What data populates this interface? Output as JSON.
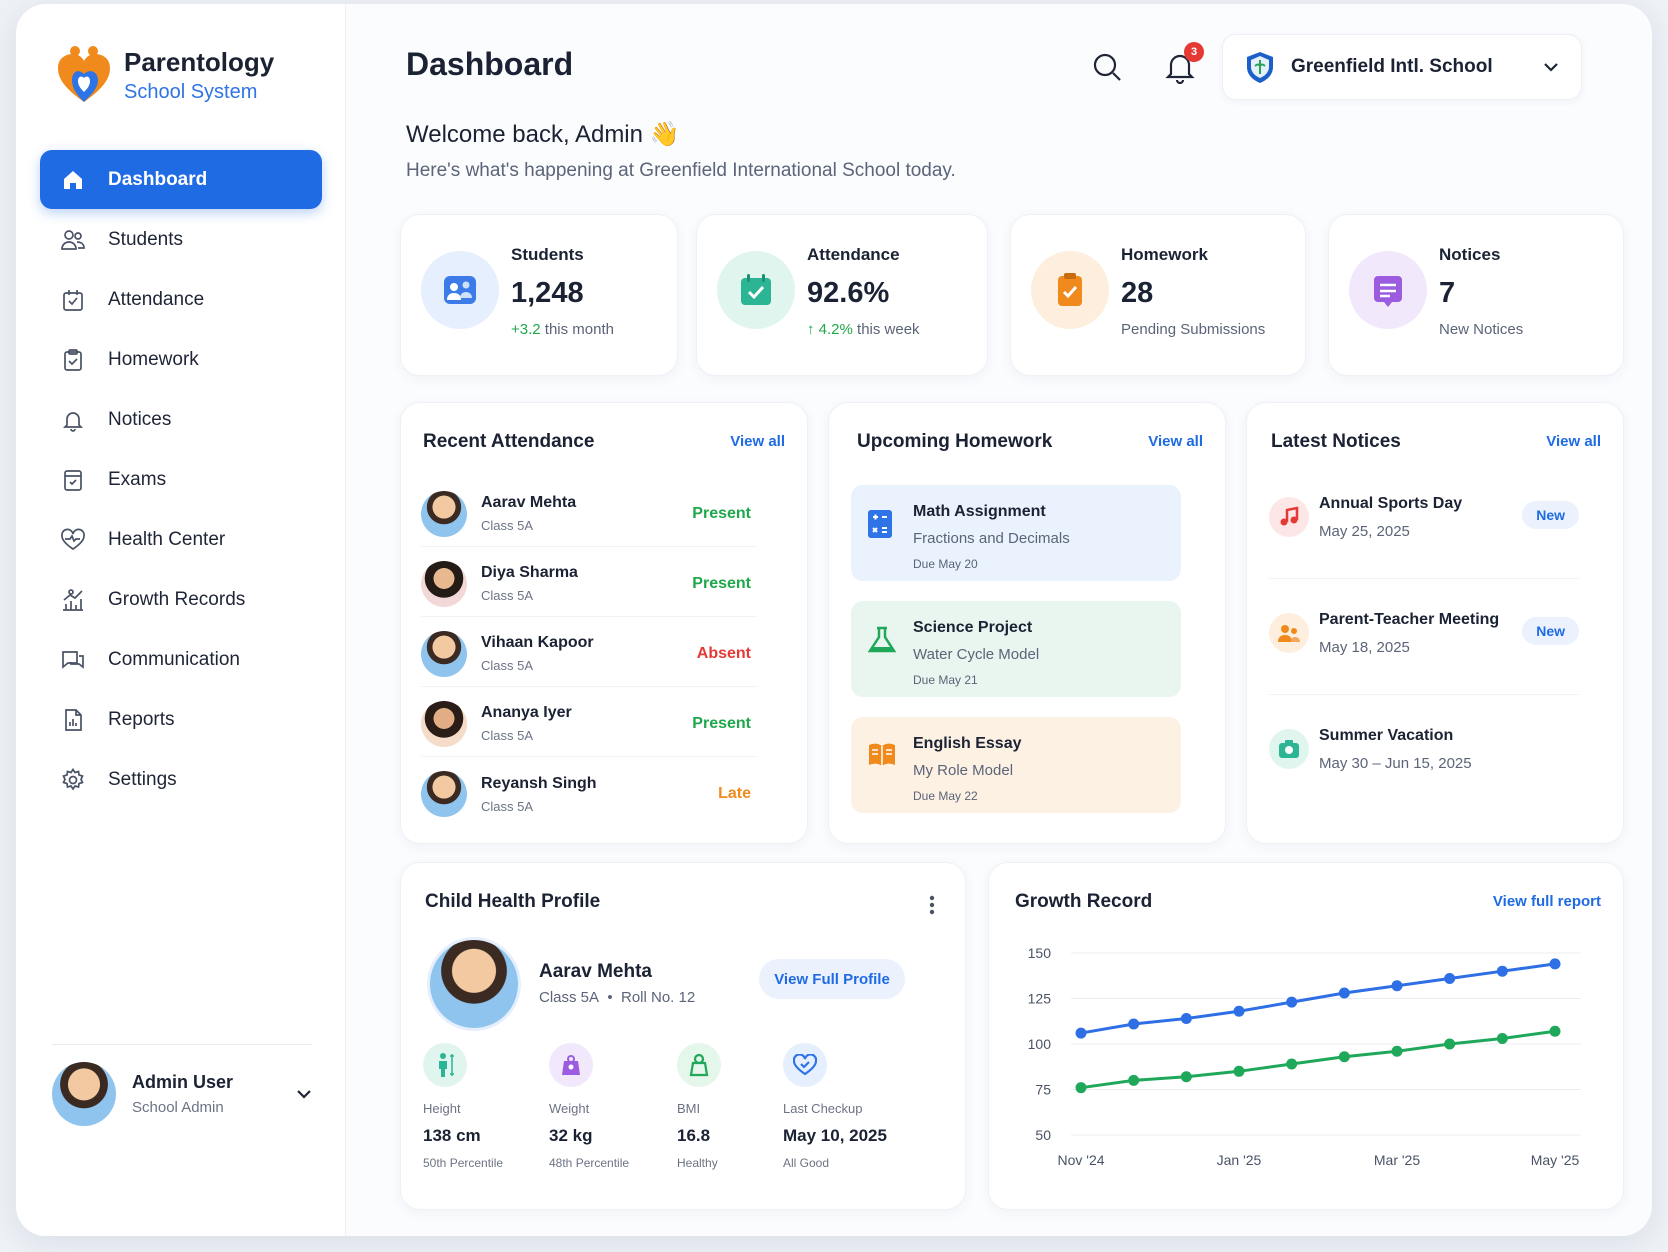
{
  "app": {
    "name": "Parentology",
    "subtitle": "School System"
  },
  "colors": {
    "primary": "#1f6be4",
    "green": "#1ea84b",
    "red": "#e53935",
    "orange": "#f08a1c"
  },
  "nav": [
    {
      "label": "Dashboard",
      "icon": "home-icon"
    },
    {
      "label": "Students",
      "icon": "users-icon"
    },
    {
      "label": "Attendance",
      "icon": "calendar-check-icon"
    },
    {
      "label": "Homework",
      "icon": "clipboard-icon"
    },
    {
      "label": "Notices",
      "icon": "bell-icon"
    },
    {
      "label": "Exams",
      "icon": "exam-icon"
    },
    {
      "label": "Health Center",
      "icon": "heart-pulse-icon"
    },
    {
      "label": "Growth Records",
      "icon": "growth-icon"
    },
    {
      "label": "Communication",
      "icon": "chat-icon"
    },
    {
      "label": "Reports",
      "icon": "report-icon"
    },
    {
      "label": "Settings",
      "icon": "gear-icon"
    }
  ],
  "user": {
    "name": "Admin User",
    "role": "School Admin"
  },
  "header": {
    "title": "Dashboard",
    "notification_count": "3",
    "school": "Greenfield Intl. School"
  },
  "welcome": {
    "title": "Welcome back, Admin 👋",
    "subtitle": "Here's what's happening at Greenfield International School today."
  },
  "stats": [
    {
      "label": "Students",
      "value": "1,248",
      "delta": "+3.2",
      "sub": " this month"
    },
    {
      "label": "Attendance",
      "value": "92.6%",
      "delta": "↑ 4.2%",
      "sub": " this week"
    },
    {
      "label": "Homework",
      "value": "28",
      "delta": "",
      "sub": "Pending Submissions"
    },
    {
      "label": "Notices",
      "value": "7",
      "delta": "",
      "sub": "New Notices"
    }
  ],
  "attendance": {
    "title": "Recent Attendance",
    "view_all": "View all",
    "rows": [
      {
        "name": "Aarav Mehta",
        "class": "Class 5A",
        "status": "Present"
      },
      {
        "name": "Diya Sharma",
        "class": "Class 5A",
        "status": "Present"
      },
      {
        "name": "Vihaan Kapoor",
        "class": "Class 5A",
        "status": "Absent"
      },
      {
        "name": "Ananya Iyer",
        "class": "Class 5A",
        "status": "Present"
      },
      {
        "name": "Reyansh Singh",
        "class": "Class 5A",
        "status": "Late"
      }
    ]
  },
  "homework": {
    "title": "Upcoming Homework",
    "view_all": "View all",
    "items": [
      {
        "title": "Math Assignment",
        "sub": "Fractions and Decimals",
        "due": "Due May 20"
      },
      {
        "title": "Science Project",
        "sub": "Water Cycle Model",
        "due": "Due May 21"
      },
      {
        "title": "English Essay",
        "sub": "My Role Model",
        "due": "Due May 22"
      }
    ]
  },
  "notices": {
    "title": "Latest Notices",
    "view_all": "View all",
    "items": [
      {
        "title": "Annual Sports Day",
        "date": "May 25, 2025",
        "badge": "New"
      },
      {
        "title": "Parent-Teacher Meeting",
        "date": "May 18, 2025",
        "badge": "New"
      },
      {
        "title": "Summer Vacation",
        "date": "May 30 – Jun 15, 2025",
        "badge": ""
      }
    ]
  },
  "health": {
    "title": "Child Health Profile",
    "name": "Aarav Mehta",
    "class": "Class 5A",
    "sep": "•",
    "roll": "Roll No. 12",
    "button": "View Full Profile",
    "metrics": [
      {
        "label": "Height",
        "value": "138 cm",
        "sub": "50th Percentile"
      },
      {
        "label": "Weight",
        "value": "32 kg",
        "sub": "48th Percentile"
      },
      {
        "label": "BMI",
        "value": "16.8",
        "sub": "Healthy"
      },
      {
        "label": "Last Checkup",
        "value": "May 10, 2025",
        "sub": "All Good"
      }
    ]
  },
  "growth": {
    "title": "Growth Record",
    "view_all": "View full report",
    "chart_data": {
      "type": "line",
      "x": [
        1,
        2,
        3,
        4,
        5,
        6,
        7,
        8,
        9,
        10
      ],
      "xticks": [
        "Nov '24",
        "Jan '25",
        "Mar '25",
        "May '25"
      ],
      "xtick_positions": [
        1,
        4,
        7,
        10
      ],
      "yticks": [
        "150",
        "125",
        "100",
        "75",
        "50"
      ],
      "ylim": [
        50,
        150
      ],
      "grid": true,
      "series": [
        {
          "color": "#2f6fe6",
          "values": [
            106,
            111,
            114,
            118,
            123,
            128,
            132,
            136,
            140,
            144
          ]
        },
        {
          "color": "#1fa85a",
          "values": [
            76,
            80,
            82,
            85,
            89,
            93,
            96,
            100,
            103,
            107
          ]
        }
      ]
    }
  }
}
